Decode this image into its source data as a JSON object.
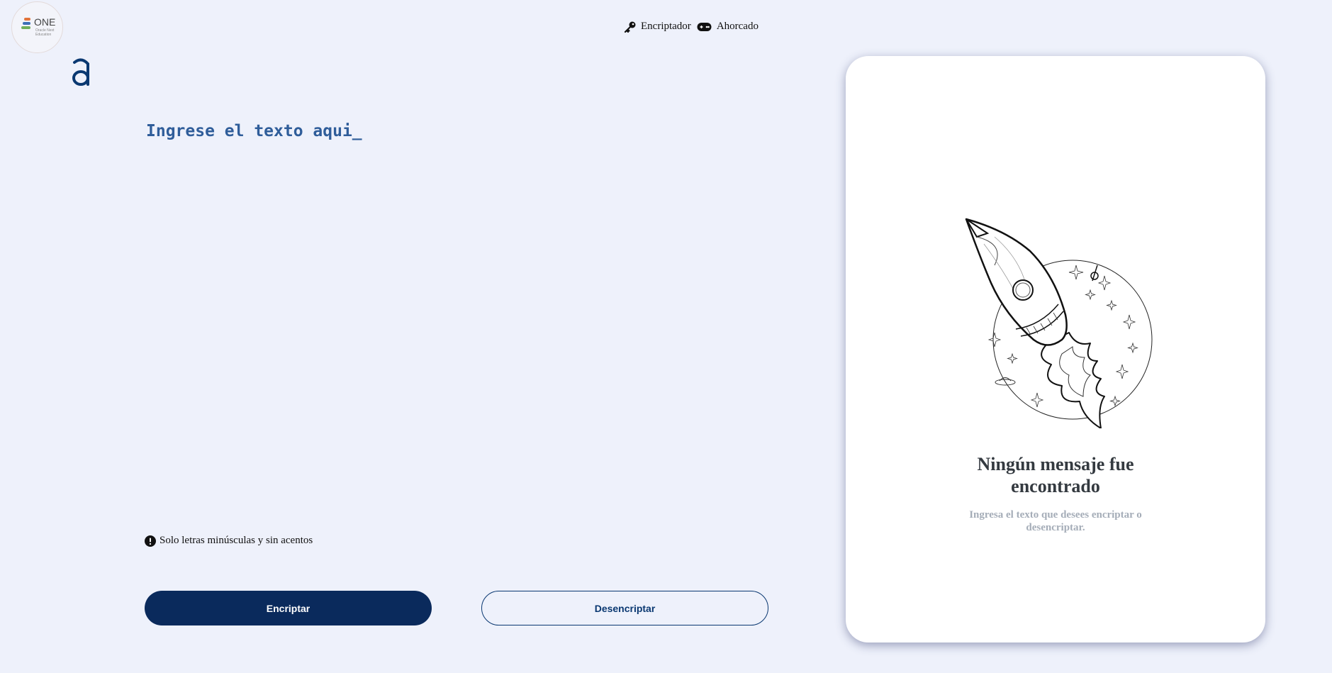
{
  "brand": {
    "one_text": "ONE",
    "one_sub": "Oracle Next Education",
    "bar_colors": [
      "#e2733a",
      "#3d6fb6",
      "#6fae5a"
    ],
    "accent": "#0a2a5c"
  },
  "nav": {
    "encriptador": "Encriptador",
    "ahorcado": "Ahorcado"
  },
  "input": {
    "placeholder": "Ingrese el texto aqui_",
    "value": ""
  },
  "hint": "Solo letras minúsculas y sin acentos",
  "buttons": {
    "encrypt": "Encriptar",
    "decrypt": "Desencriptar"
  },
  "output": {
    "title_line1": "Ningún mensaje fue",
    "title_line2": "encontrado",
    "subtitle": "Ingresa el texto que desees encriptar o desencriptar."
  },
  "icons": [
    "key-icon",
    "gamepad-icon",
    "exclamation-circle-icon",
    "rocket-illustration"
  ]
}
